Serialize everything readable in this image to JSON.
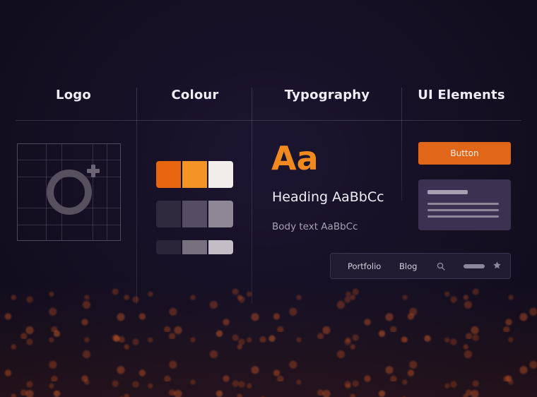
{
  "columns": {
    "logo": "Logo",
    "colour": "Colour",
    "typography": "Typography",
    "ui_elements": "UI Elements"
  },
  "colour": {
    "palettes": [
      [
        "#e8650f",
        "#f49426",
        "#f1edea"
      ],
      [
        "#2f2a3d",
        "#544d63",
        "#8e8795"
      ],
      [
        "#2a2538",
        "#77707f",
        "#c3bec6"
      ]
    ]
  },
  "typography": {
    "display_sample": "Aa",
    "heading_sample": "Heading AaBbCc",
    "body_sample": "Body text AaBbCc",
    "accent_color": "#f08a1e"
  },
  "ui_elements": {
    "button_label": "Button",
    "button_color": "#e0661a",
    "nav": {
      "items": [
        "Portfolio",
        "Blog"
      ],
      "icons": [
        "search-icon",
        "star-icon"
      ]
    }
  }
}
